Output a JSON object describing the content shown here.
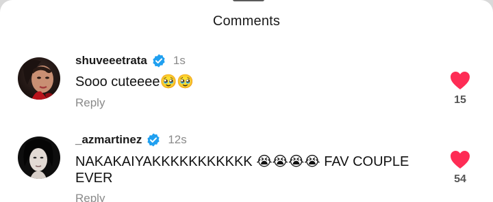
{
  "sheet": {
    "title": "Comments"
  },
  "comments": [
    {
      "username": "shuveeetrata",
      "verified": true,
      "timestamp": "1s",
      "text": "Sooo cuteeee🥹🥹",
      "reply_label": "Reply",
      "likes": "15",
      "liked": true
    },
    {
      "username": "_azmartinez",
      "verified": true,
      "timestamp": "12s",
      "text": "NAKAKAIYAKKKKKKKKKKK 😭😭😭😭 FAV COUPLE EVER",
      "reply_label": "Reply",
      "likes": "54",
      "liked": true
    }
  ],
  "colors": {
    "heart": "#fe2c55",
    "verified_badge": "#20a0f0",
    "muted_text": "#8a8a8a"
  },
  "icons": {
    "verified": "verified-check-icon",
    "like": "heart-icon"
  }
}
